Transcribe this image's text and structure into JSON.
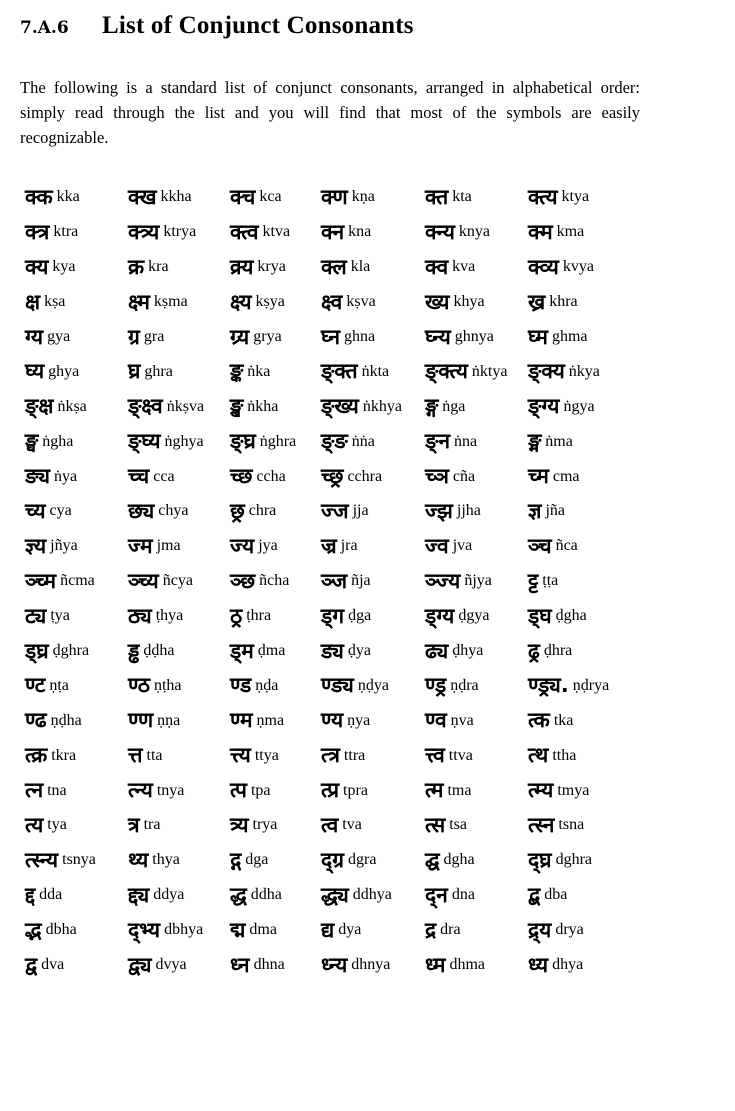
{
  "section": {
    "number": "7.A.6",
    "title": "List of Conjunct Consonants",
    "intro": "The following is a standard list of conjunct consonants, arranged in alphabetical order: simply read through the list and you will find that most of the symbols are easily recognizable."
  },
  "conjuncts": [
    {
      "deva": "क्क",
      "tr": "kka"
    },
    {
      "deva": "क्ख",
      "tr": "kkha"
    },
    {
      "deva": "क्च",
      "tr": "kca"
    },
    {
      "deva": "क्ण",
      "tr": "kṇa"
    },
    {
      "deva": "क्त",
      "tr": "kta"
    },
    {
      "deva": "क्त्य",
      "tr": "ktya"
    },
    {
      "deva": "क्त्र",
      "tr": "ktra"
    },
    {
      "deva": "क्त्र्य",
      "tr": "ktrya"
    },
    {
      "deva": "क्त्व",
      "tr": "ktva"
    },
    {
      "deva": "क्न",
      "tr": "kna"
    },
    {
      "deva": "क्न्य",
      "tr": "knya"
    },
    {
      "deva": "क्म",
      "tr": "kma"
    },
    {
      "deva": "क्य",
      "tr": "kya"
    },
    {
      "deva": "क्र",
      "tr": "kra"
    },
    {
      "deva": "क्र्य",
      "tr": "krya"
    },
    {
      "deva": "क्ल",
      "tr": "kla"
    },
    {
      "deva": "क्व",
      "tr": "kva"
    },
    {
      "deva": "क्व्य",
      "tr": "kvya"
    },
    {
      "deva": "क्ष",
      "tr": "kṣa"
    },
    {
      "deva": "क्ष्म",
      "tr": "kṣma"
    },
    {
      "deva": "क्ष्य",
      "tr": "kṣya"
    },
    {
      "deva": "क्ष्व",
      "tr": "kṣva"
    },
    {
      "deva": "ख्य",
      "tr": "khya"
    },
    {
      "deva": "ख्र",
      "tr": "khra"
    },
    {
      "deva": "ग्य",
      "tr": "gya"
    },
    {
      "deva": "ग्र",
      "tr": "gra"
    },
    {
      "deva": "ग्र्य",
      "tr": "grya"
    },
    {
      "deva": "घ्न",
      "tr": "ghna"
    },
    {
      "deva": "घ्न्य",
      "tr": "ghnya"
    },
    {
      "deva": "घ्म",
      "tr": "ghma"
    },
    {
      "deva": "घ्य",
      "tr": "ghya"
    },
    {
      "deva": "घ्र",
      "tr": "ghra"
    },
    {
      "deva": "ङ्क",
      "tr": "ṅka"
    },
    {
      "deva": "ङ्क्त",
      "tr": "ṅkta"
    },
    {
      "deva": "ङ्क्त्य",
      "tr": "ṅktya"
    },
    {
      "deva": "ङ्क्य",
      "tr": "ṅkya"
    },
    {
      "deva": "ङ्क्ष",
      "tr": "ṅkṣa"
    },
    {
      "deva": "ङ्क्ष्व",
      "tr": "ṅkṣva"
    },
    {
      "deva": "ङ्ख",
      "tr": "ṅkha"
    },
    {
      "deva": "ङ्ख्य",
      "tr": "ṅkhya"
    },
    {
      "deva": "ङ्ग",
      "tr": "ṅga"
    },
    {
      "deva": "ङ्ग्य",
      "tr": "ṅgya"
    },
    {
      "deva": "ङ्घ",
      "tr": "ṅgha"
    },
    {
      "deva": "ङ्घ्य",
      "tr": "ṅghya"
    },
    {
      "deva": "ङ्घ्र",
      "tr": "ṅghra"
    },
    {
      "deva": "ङ्ङ",
      "tr": "ṅṅa"
    },
    {
      "deva": "ङ्न",
      "tr": "ṅna"
    },
    {
      "deva": "ङ्म",
      "tr": "ṅma"
    },
    {
      "deva": "ङ्य",
      "tr": "ṅya"
    },
    {
      "deva": "च्च",
      "tr": "cca"
    },
    {
      "deva": "च्छ",
      "tr": "ccha"
    },
    {
      "deva": "च्छ्र",
      "tr": "cchra"
    },
    {
      "deva": "च्ञ",
      "tr": "cña"
    },
    {
      "deva": "च्म",
      "tr": "cma"
    },
    {
      "deva": "च्य",
      "tr": "cya"
    },
    {
      "deva": "छ्य",
      "tr": "chya"
    },
    {
      "deva": "छ्र",
      "tr": "chra"
    },
    {
      "deva": "ज्ज",
      "tr": "jja"
    },
    {
      "deva": "ज्झ",
      "tr": "jjha"
    },
    {
      "deva": "ज्ञ",
      "tr": "jña"
    },
    {
      "deva": "ज्ञ्य",
      "tr": "jñya"
    },
    {
      "deva": "ज्म",
      "tr": "jma"
    },
    {
      "deva": "ज्य",
      "tr": "jya"
    },
    {
      "deva": "ज्र",
      "tr": "jra"
    },
    {
      "deva": "ज्व",
      "tr": "jva"
    },
    {
      "deva": "ञ्च",
      "tr": "ñca"
    },
    {
      "deva": "ञ्च्म",
      "tr": "ñcma"
    },
    {
      "deva": "ञ्च्य",
      "tr": "ñcya"
    },
    {
      "deva": "ञ्छ",
      "tr": "ñcha"
    },
    {
      "deva": "ञ्ज",
      "tr": "ñja"
    },
    {
      "deva": "ञ्ज्य",
      "tr": "ñjya"
    },
    {
      "deva": "ट्ट",
      "tr": "ṭṭa"
    },
    {
      "deva": "ट्य",
      "tr": "ṭya"
    },
    {
      "deva": "ठ्य",
      "tr": "ṭhya"
    },
    {
      "deva": "ठ्र",
      "tr": "ṭhra"
    },
    {
      "deva": "ड्ग",
      "tr": "ḍga"
    },
    {
      "deva": "ड्ग्य",
      "tr": "ḍgya"
    },
    {
      "deva": "ड्घ",
      "tr": "ḍgha"
    },
    {
      "deva": "ड्घ्र",
      "tr": "ḍghra"
    },
    {
      "deva": "ड्ढ",
      "tr": "ḍḍha"
    },
    {
      "deva": "ड्म",
      "tr": "ḍma"
    },
    {
      "deva": "ड्य",
      "tr": "ḍya"
    },
    {
      "deva": "ढ्य",
      "tr": "ḍhya"
    },
    {
      "deva": "ढ्र",
      "tr": "ḍhra"
    },
    {
      "deva": "ण्ट",
      "tr": "ṇṭa"
    },
    {
      "deva": "ण्ठ",
      "tr": "ṇṭha"
    },
    {
      "deva": "ण्ड",
      "tr": "ṇḍa"
    },
    {
      "deva": "ण्ड्य",
      "tr": "ṇḍya"
    },
    {
      "deva": "ण्ड्र",
      "tr": "ṇḍra"
    },
    {
      "deva": "ण्ड्र्य.",
      "tr": "ṇḍrya"
    },
    {
      "deva": "ण्ढ",
      "tr": "ṇḍha"
    },
    {
      "deva": "ण्ण",
      "tr": "ṇṇa"
    },
    {
      "deva": "ण्म",
      "tr": "ṇma"
    },
    {
      "deva": "ण्य",
      "tr": "ṇya"
    },
    {
      "deva": "ण्व",
      "tr": "ṇva"
    },
    {
      "deva": "त्क",
      "tr": "tka"
    },
    {
      "deva": "त्क्र",
      "tr": "tkra"
    },
    {
      "deva": "त्त",
      "tr": "tta"
    },
    {
      "deva": "त्त्य",
      "tr": "ttya"
    },
    {
      "deva": "त्त्र",
      "tr": "ttra"
    },
    {
      "deva": "त्त्व",
      "tr": "ttva"
    },
    {
      "deva": "त्थ",
      "tr": "ttha"
    },
    {
      "deva": "त्न",
      "tr": "tna"
    },
    {
      "deva": "त्न्य",
      "tr": "tnya"
    },
    {
      "deva": "त्प",
      "tr": "tpa"
    },
    {
      "deva": "त्प्र",
      "tr": "tpra"
    },
    {
      "deva": "त्म",
      "tr": "tma"
    },
    {
      "deva": "त्म्य",
      "tr": "tmya"
    },
    {
      "deva": "त्य",
      "tr": "tya"
    },
    {
      "deva": "त्र",
      "tr": "tra"
    },
    {
      "deva": "त्र्य",
      "tr": "trya"
    },
    {
      "deva": "त्व",
      "tr": "tva"
    },
    {
      "deva": "त्स",
      "tr": "tsa"
    },
    {
      "deva": "त्स्न",
      "tr": "tsna"
    },
    {
      "deva": "त्स्न्य",
      "tr": "tsnya"
    },
    {
      "deva": "थ्य",
      "tr": "thya"
    },
    {
      "deva": "द्ग",
      "tr": "dga"
    },
    {
      "deva": "द्ग्र",
      "tr": "dgra"
    },
    {
      "deva": "द्घ",
      "tr": "dgha"
    },
    {
      "deva": "द्घ्र",
      "tr": "dghra"
    },
    {
      "deva": "द्द",
      "tr": "dda"
    },
    {
      "deva": "द्द्य",
      "tr": "ddya"
    },
    {
      "deva": "द्ध",
      "tr": "ddha"
    },
    {
      "deva": "द्ध्य",
      "tr": "ddhya"
    },
    {
      "deva": "द्न",
      "tr": "dna"
    },
    {
      "deva": "द्ब",
      "tr": "dba"
    },
    {
      "deva": "द्भ",
      "tr": "dbha"
    },
    {
      "deva": "द्भ्य",
      "tr": "dbhya"
    },
    {
      "deva": "द्म",
      "tr": "dma"
    },
    {
      "deva": "द्य",
      "tr": "dya"
    },
    {
      "deva": "द्र",
      "tr": "dra"
    },
    {
      "deva": "द्र्य",
      "tr": "drya"
    },
    {
      "deva": "द्व",
      "tr": "dva"
    },
    {
      "deva": "द्व्य",
      "tr": "dvya"
    },
    {
      "deva": "ध्न",
      "tr": "dhna"
    },
    {
      "deva": "ध्न्य",
      "tr": "dhnya"
    },
    {
      "deva": "ध्म",
      "tr": "dhma"
    },
    {
      "deva": "ध्य",
      "tr": "dhya"
    }
  ]
}
